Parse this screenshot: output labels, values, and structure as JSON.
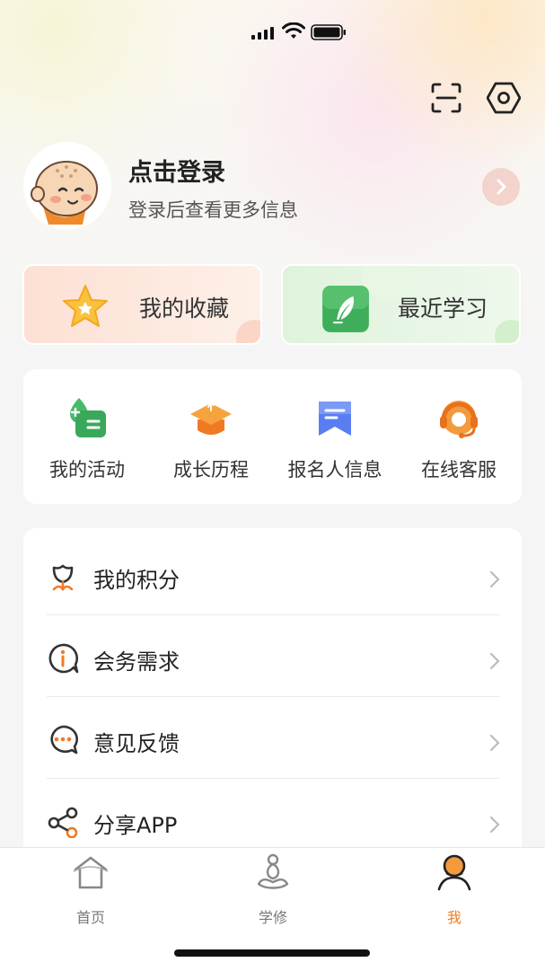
{
  "status_bar": {
    "battery_level": 0.9
  },
  "header": {
    "scan_icon": "scan-icon",
    "settings_icon": "settings-hexagon-icon"
  },
  "profile": {
    "title": "点击登录",
    "subtitle": "登录后查看更多信息"
  },
  "shortcuts": [
    {
      "label": "我的收藏",
      "icon": "star-icon"
    },
    {
      "label": "最近学习",
      "icon": "feather-book-icon"
    }
  ],
  "grid": [
    {
      "label": "我的活动",
      "icon": "activity-card-icon"
    },
    {
      "label": "成长历程",
      "icon": "graduation-cap-icon"
    },
    {
      "label": "报名人信息",
      "icon": "bookmark-icon"
    },
    {
      "label": "在线客服",
      "icon": "headset-icon"
    }
  ],
  "menu": [
    {
      "label": "我的积分",
      "icon": "flower-icon"
    },
    {
      "label": "会务需求",
      "icon": "info-bubble-icon"
    },
    {
      "label": "意见反馈",
      "icon": "chat-bubble-icon"
    },
    {
      "label": "分享APP",
      "icon": "share-icon"
    }
  ],
  "tabs": [
    {
      "label": "首页",
      "icon": "home-icon"
    },
    {
      "label": "学修",
      "icon": "meditation-icon"
    },
    {
      "label": "我",
      "icon": "user-icon",
      "active": true
    }
  ],
  "colors": {
    "accent": "#ef7e23",
    "fav_bg": "#fde0d4",
    "recent_bg": "#dff3dc"
  }
}
